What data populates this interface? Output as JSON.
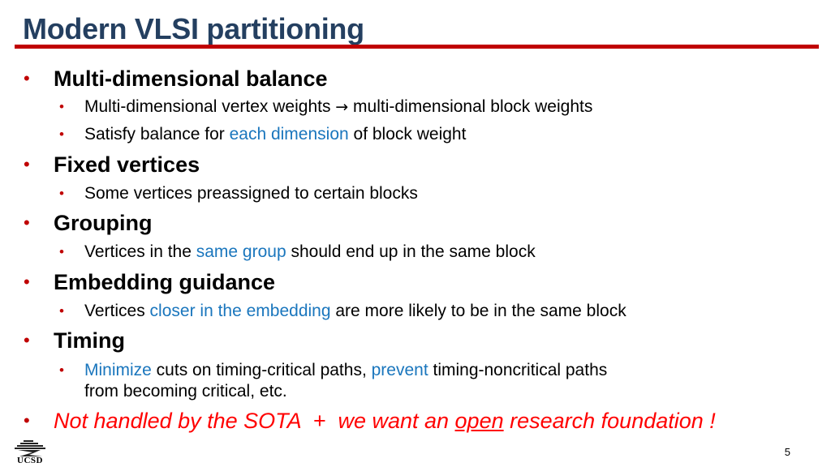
{
  "slide": {
    "title": "Modern VLSI partitioning",
    "page_number": "5",
    "logo_text": "UCSD",
    "colors": {
      "title": "#243f60",
      "rule": "#c00000",
      "bullet": "#c00000",
      "highlight": "#1a76bd",
      "emphasis": "#ff0000"
    },
    "bullets": [
      {
        "label": "Multi-dimensional balance",
        "sub": [
          {
            "parts": [
              {
                "text": "Multi-dimensional vertex weights "
              },
              {
                "text": "→",
                "icon": "arrow-right-icon"
              },
              {
                "text": " multi-dimensional block weights"
              }
            ]
          },
          {
            "parts": [
              {
                "text": "Satisfy balance for "
              },
              {
                "text": "each dimension",
                "highlight": true
              },
              {
                "text": " of block weight"
              }
            ]
          }
        ]
      },
      {
        "label": "Fixed vertices",
        "sub": [
          {
            "parts": [
              {
                "text": "Some vertices preassigned to certain blocks"
              }
            ]
          }
        ]
      },
      {
        "label": "Grouping",
        "sub": [
          {
            "parts": [
              {
                "text": "Vertices in the "
              },
              {
                "text": "same group",
                "highlight": true
              },
              {
                "text": " should end up in the same block"
              }
            ]
          }
        ]
      },
      {
        "label": "Embedding guidance",
        "sub": [
          {
            "parts": [
              {
                "text": "Vertices "
              },
              {
                "text": "closer in the embedding",
                "highlight": true
              },
              {
                "text": " are more likely to be in the same block"
              }
            ]
          }
        ]
      },
      {
        "label": "Timing",
        "sub": [
          {
            "parts": [
              {
                "text": "Minimize",
                "highlight": true
              },
              {
                "text": " cuts on timing-critical paths, "
              },
              {
                "text": "prevent",
                "highlight": true
              },
              {
                "text": " timing-noncritical paths"
              }
            ],
            "line2": "from becoming critical, etc."
          }
        ]
      }
    ],
    "final_note": {
      "before": "Not handled by the SOTA  +  we want an ",
      "underlined": "open",
      "after": " research foundation !"
    }
  }
}
